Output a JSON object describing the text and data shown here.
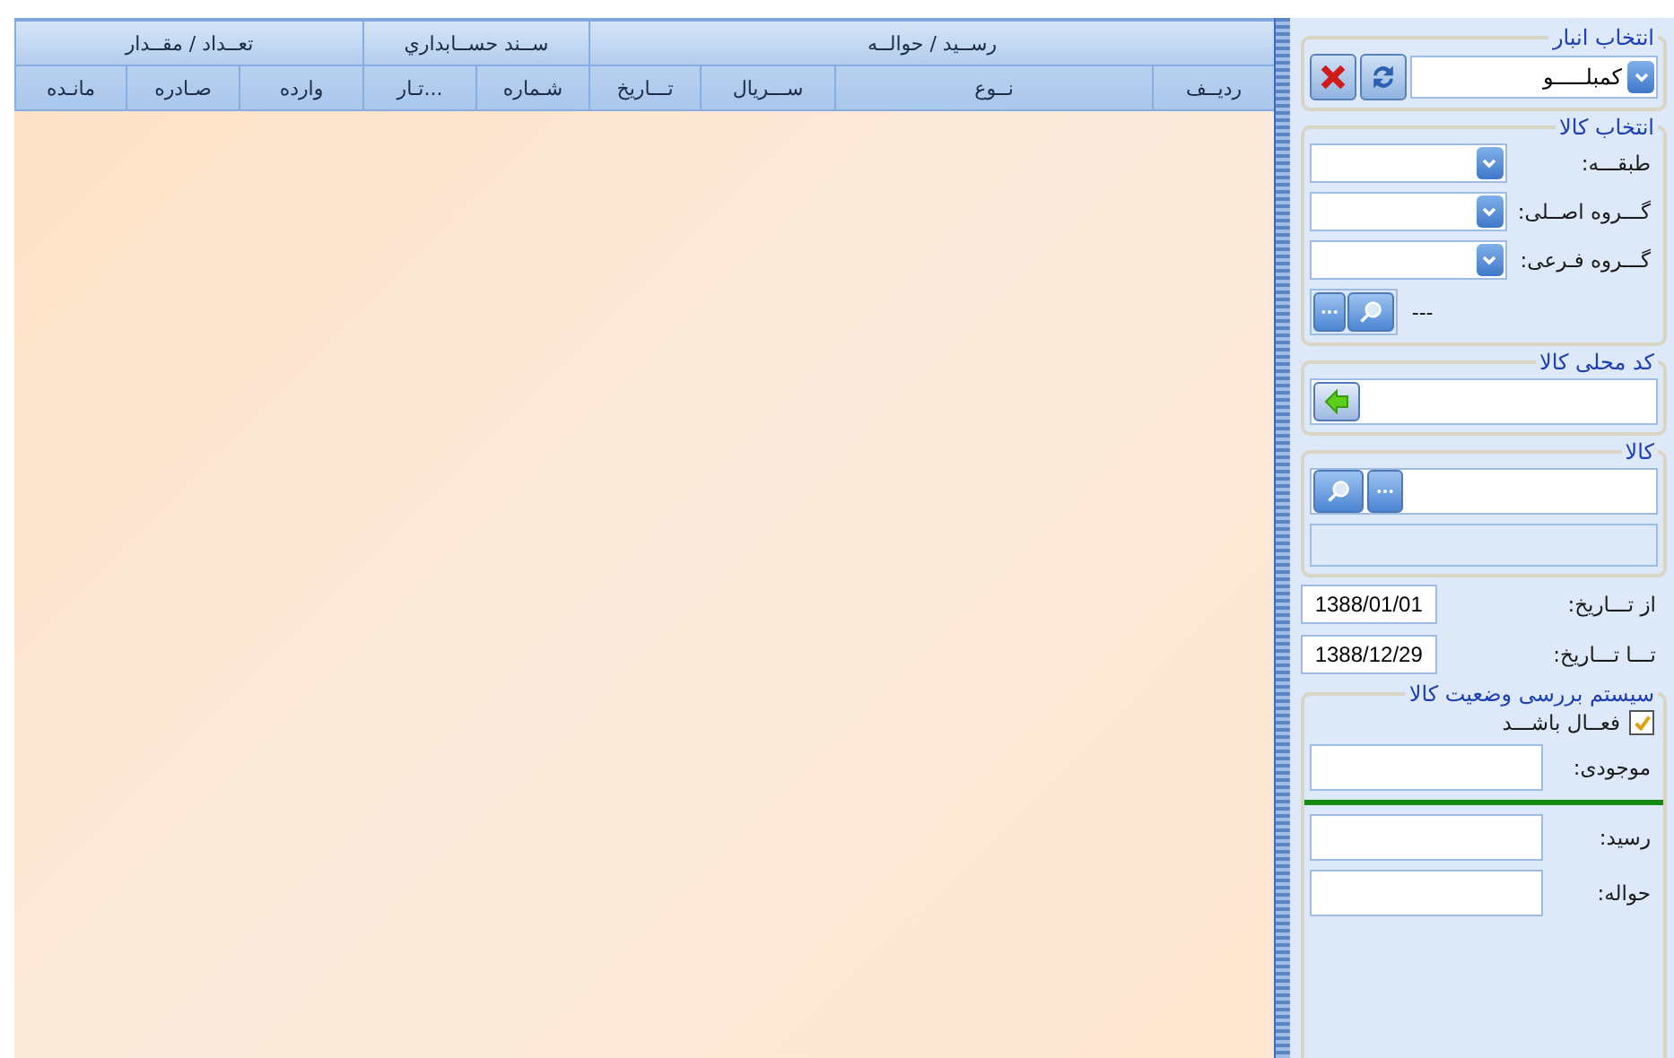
{
  "grid": {
    "groups": [
      {
        "label": "رســید / حوالــه",
        "columns": [
          "ردیــف",
          "نــوع",
          "ســـریال",
          "تـــاریخ"
        ]
      },
      {
        "label": "ســند حســابداري",
        "columns": [
          "شـماره",
          "...تـار"
        ]
      },
      {
        "label": "تعــداد / مقــدار",
        "columns": [
          "وارده",
          "صـادره",
          "مانـده"
        ]
      }
    ]
  },
  "panel": {
    "warehouse": {
      "title": "انتخاب انبار",
      "value": "کمبلـــــو"
    },
    "goods_select": {
      "title": "انتخاب کالا",
      "combos": [
        {
          "label": "طبقـــه:"
        },
        {
          "label": "گـــروه اصــلی:"
        },
        {
          "label": "گـــروه فـرعی:"
        }
      ],
      "note": "---"
    },
    "local_code": {
      "title": "کد محلی کالا"
    },
    "goods": {
      "title": "کالا"
    },
    "dates": [
      {
        "label": "از تـــاریخ:",
        "value": "1388/01/01"
      },
      {
        "label": "تـــا تـــاریخ:",
        "value": "1388/12/29"
      }
    ],
    "status": {
      "title": "سیستم بررسی وضعیت کالا",
      "active": {
        "label": "فعــال باشـــد",
        "checked": true
      },
      "fields": [
        {
          "label": "موجودی:"
        },
        {
          "label": "رسید:"
        },
        {
          "label": "حواله:"
        }
      ]
    }
  }
}
